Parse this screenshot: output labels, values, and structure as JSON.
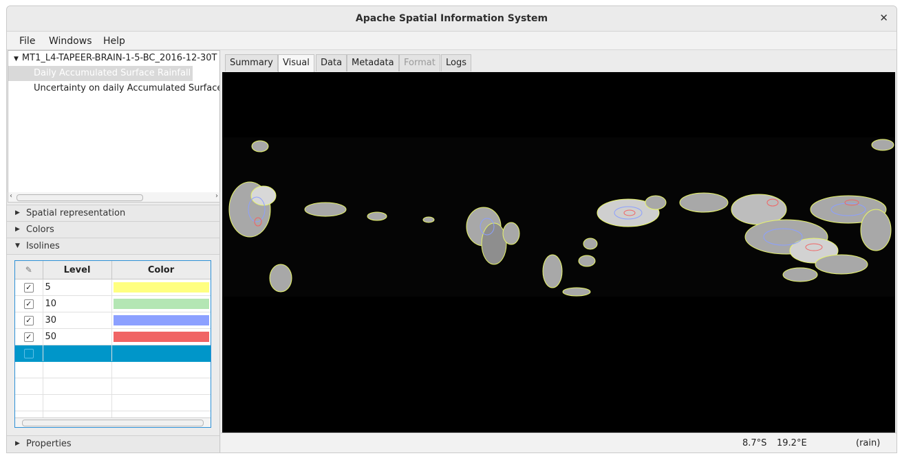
{
  "window": {
    "title": "Apache Spatial Information System"
  },
  "menu": [
    "File",
    "Windows",
    "Help"
  ],
  "tree": {
    "root": "MT1_L4-TAPEER-BRAIN-1-5-BC_2016-12-30T",
    "children": [
      "Daily Accumulated Surface Rainfall",
      "Uncertainty on daily Accumulated Surface"
    ]
  },
  "sections": {
    "spatial": "Spatial representation",
    "colors": "Colors",
    "isolines": "Isolines",
    "properties": "Properties"
  },
  "isolines_table": {
    "headers": {
      "level": "Level",
      "color": "Color"
    },
    "rows": [
      {
        "level": "5",
        "color": "#ffff80"
      },
      {
        "level": "10",
        "color": "#b4e6b4"
      },
      {
        "level": "30",
        "color": "#8ca0ff"
      },
      {
        "level": "50",
        "color": "#f06464"
      }
    ]
  },
  "tabs": [
    "Summary",
    "Visual",
    "Data",
    "Metadata",
    "Format",
    "Logs"
  ],
  "status": {
    "lat": "8.7°S",
    "lon": "19.2°E",
    "variable": "(rain)"
  }
}
